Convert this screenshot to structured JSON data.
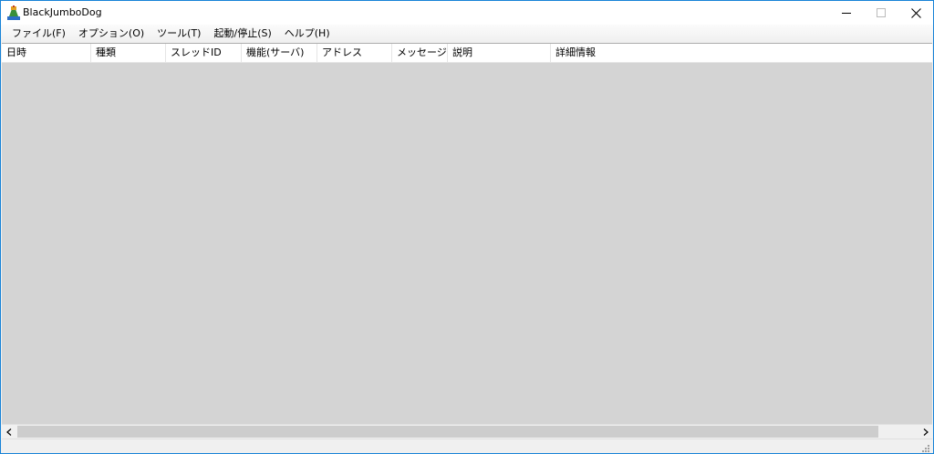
{
  "window": {
    "title": "BlackJumboDog"
  },
  "menu": [
    {
      "label": "ファイル(F)"
    },
    {
      "label": "オプション(O)"
    },
    {
      "label": "ツール(T)"
    },
    {
      "label": "起動/停止(S)"
    },
    {
      "label": "ヘルプ(H)"
    }
  ],
  "columns": [
    "日時",
    "種類",
    "スレッドID",
    "機能(サーバ)",
    "アドレス",
    "メッセージID",
    "説明",
    "詳細情報"
  ],
  "colors": {
    "title_border": "#1883d7",
    "list_background": "#d4d4d4",
    "scroll_thumb": "#cdcdcd"
  }
}
